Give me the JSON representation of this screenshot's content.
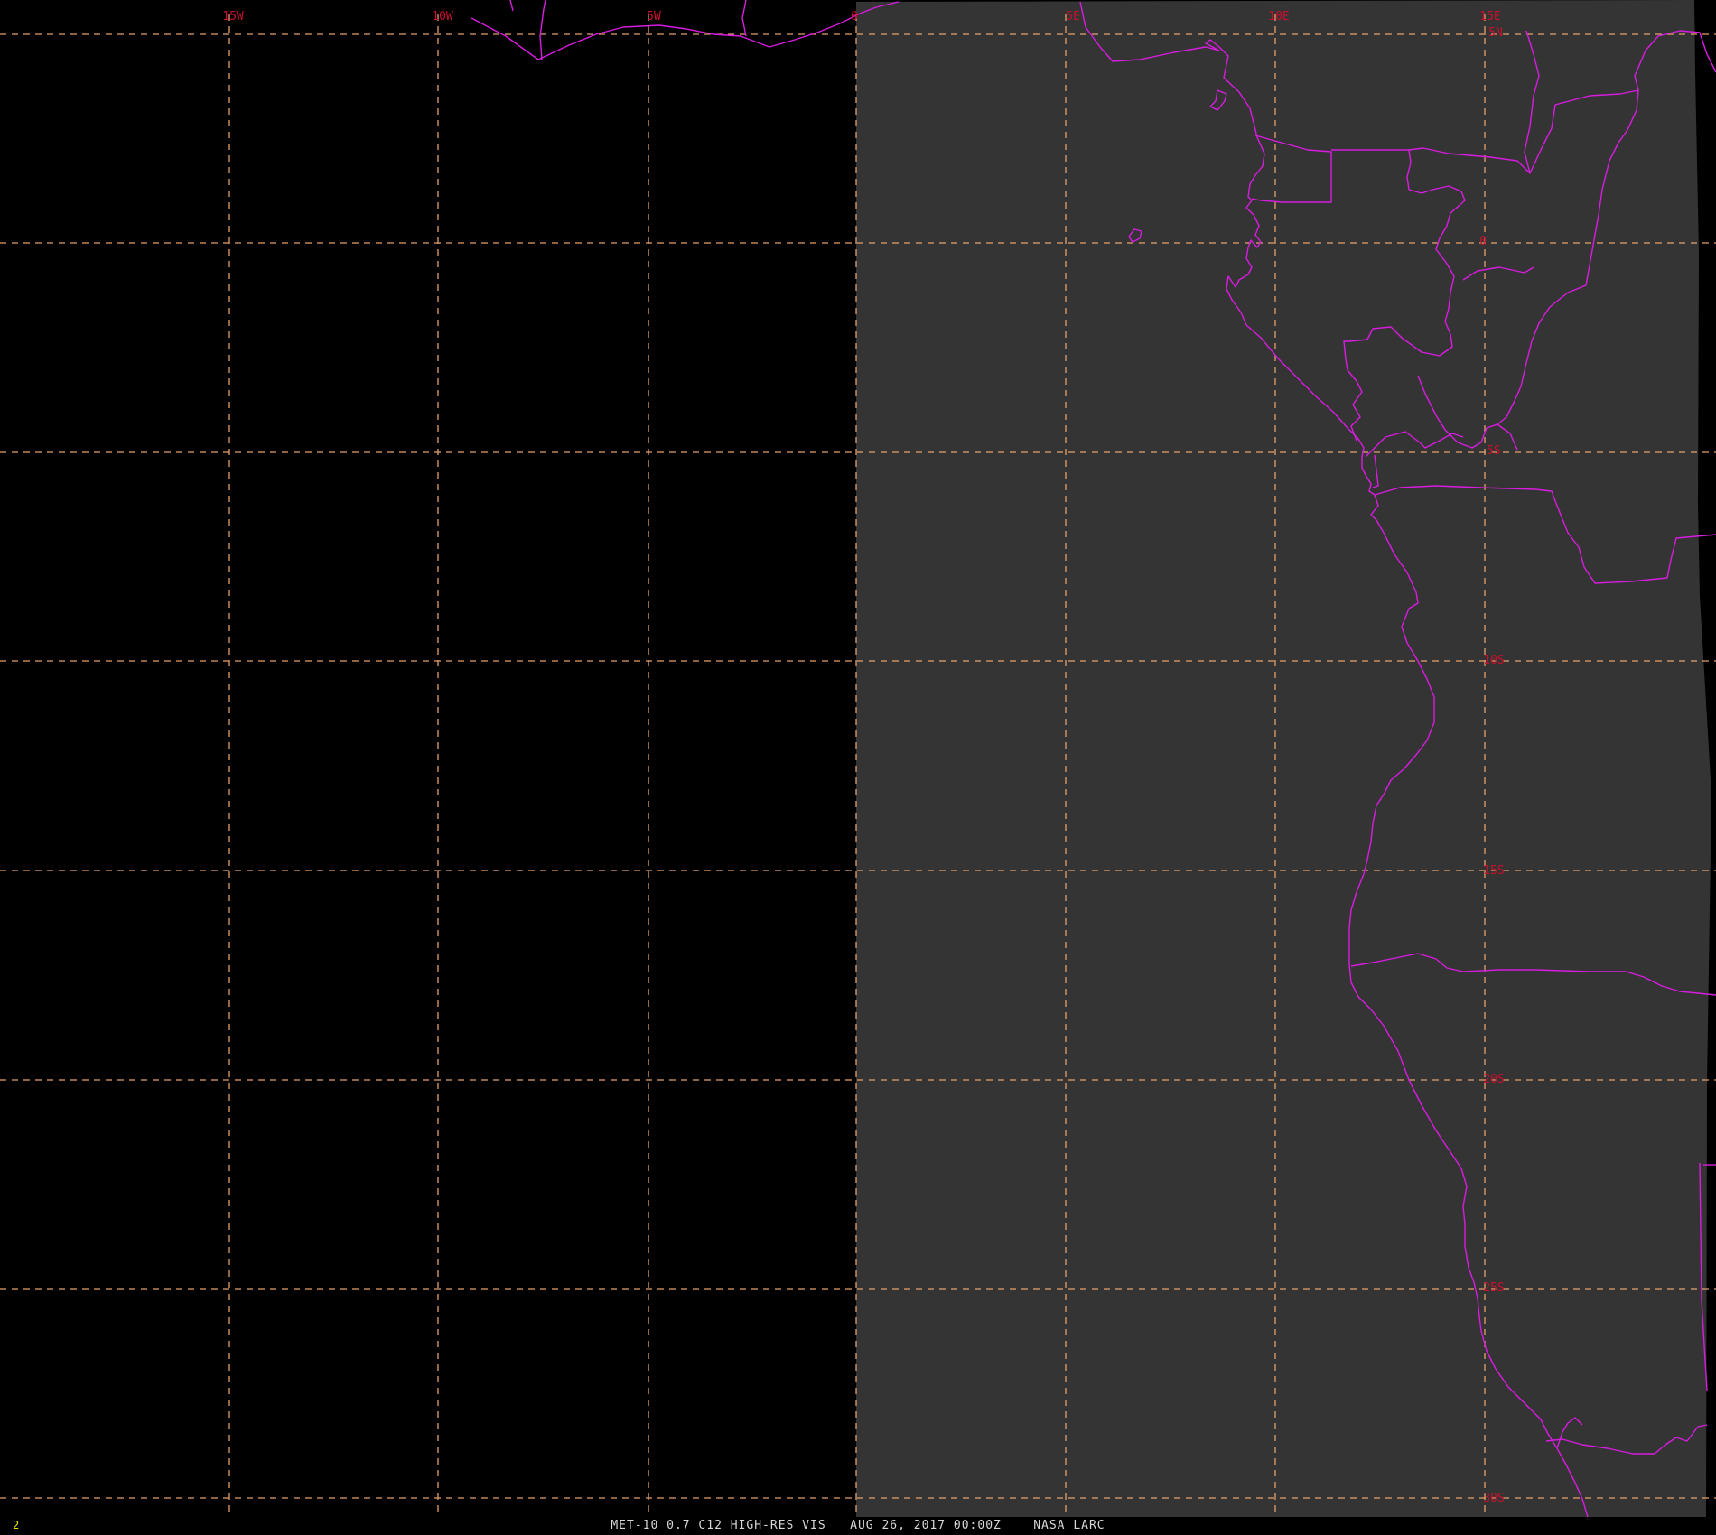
{
  "map": {
    "longitude_labels": [
      "15W",
      "10W",
      "5W",
      "0",
      "5E",
      "10E",
      "15E"
    ],
    "latitude_labels": [
      "5N",
      "0",
      "5S",
      "10S",
      "15S",
      "20S",
      "25S",
      "30S"
    ],
    "colors": {
      "background": "#000000",
      "image_area": "#333333",
      "grid": "#e3a06a",
      "grid_labels": "#c8102e",
      "borders": "#d81ce0",
      "frame_number": "#e8e800",
      "caption": "#d8d8d8"
    }
  },
  "status": {
    "frame_number": "2",
    "product": "MET-10 0.7 C12 HIGH-RES VIS",
    "datetime": "AUG 26, 2017 00:00Z",
    "source": "NASA LARC"
  }
}
